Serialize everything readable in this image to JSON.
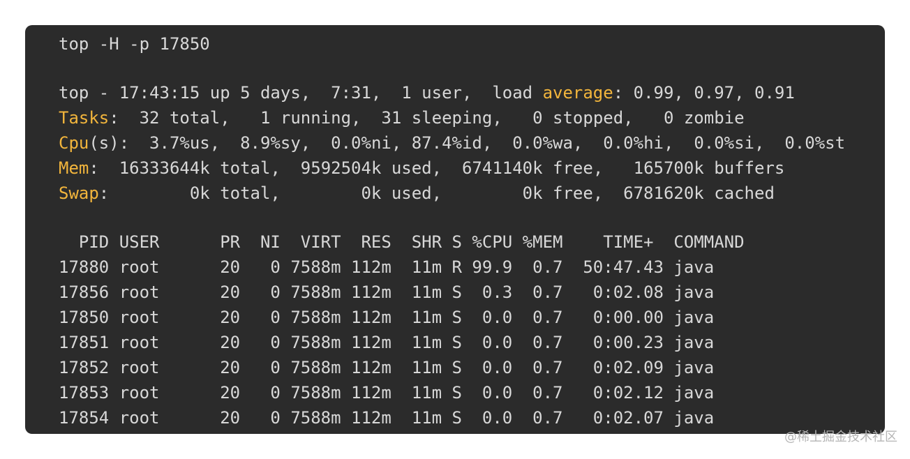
{
  "command": "top -H -p 17850",
  "summary": {
    "uptime_line": {
      "before_keyword": "top - 17:43:15 up 5 days,  7:31,  1 user,  load ",
      "keyword": "average",
      "after_keyword": ": 0.99, 0.97, 0.91"
    },
    "tasks_line": {
      "keyword": "Tasks",
      "rest": ":  32 total,   1 running,  31 sleeping,   0 stopped,   0 zombie"
    },
    "cpu_line": {
      "keyword": "Cpu",
      "rest": "(s):  3.7%us,  8.9%sy,  0.0%ni, 87.4%id,  0.0%wa,  0.0%hi,  0.0%si,  0.0%st"
    },
    "mem_line": {
      "keyword": "Mem",
      "rest": ":  16333644k total,  9592504k used,  6741140k free,   165700k buffers"
    },
    "swap_line": {
      "keyword": "Swap",
      "rest": ":        0k total,        0k used,        0k free,  6781620k cached"
    }
  },
  "table": {
    "header": "  PID USER      PR  NI  VIRT  RES  SHR S %CPU %MEM    TIME+  COMMAND",
    "rows": [
      "17880 root      20   0 7588m 112m  11m R 99.9  0.7  50:47.43 java",
      "17856 root      20   0 7588m 112m  11m S  0.3  0.7   0:02.08 java",
      "17850 root      20   0 7588m 112m  11m S  0.0  0.7   0:00.00 java",
      "17851 root      20   0 7588m 112m  11m S  0.0  0.7   0:00.23 java",
      "17852 root      20   0 7588m 112m  11m S  0.0  0.7   0:02.09 java",
      "17853 root      20   0 7588m 112m  11m S  0.0  0.7   0:02.12 java",
      "17854 root      20   0 7588m 112m  11m S  0.0  0.7   0:02.07 java"
    ]
  },
  "colors": {
    "background": "#2b2b2b",
    "text": "#d8d8d8",
    "keyword": "#f2b53c"
  },
  "watermark": "@稀土掘金技术社区"
}
